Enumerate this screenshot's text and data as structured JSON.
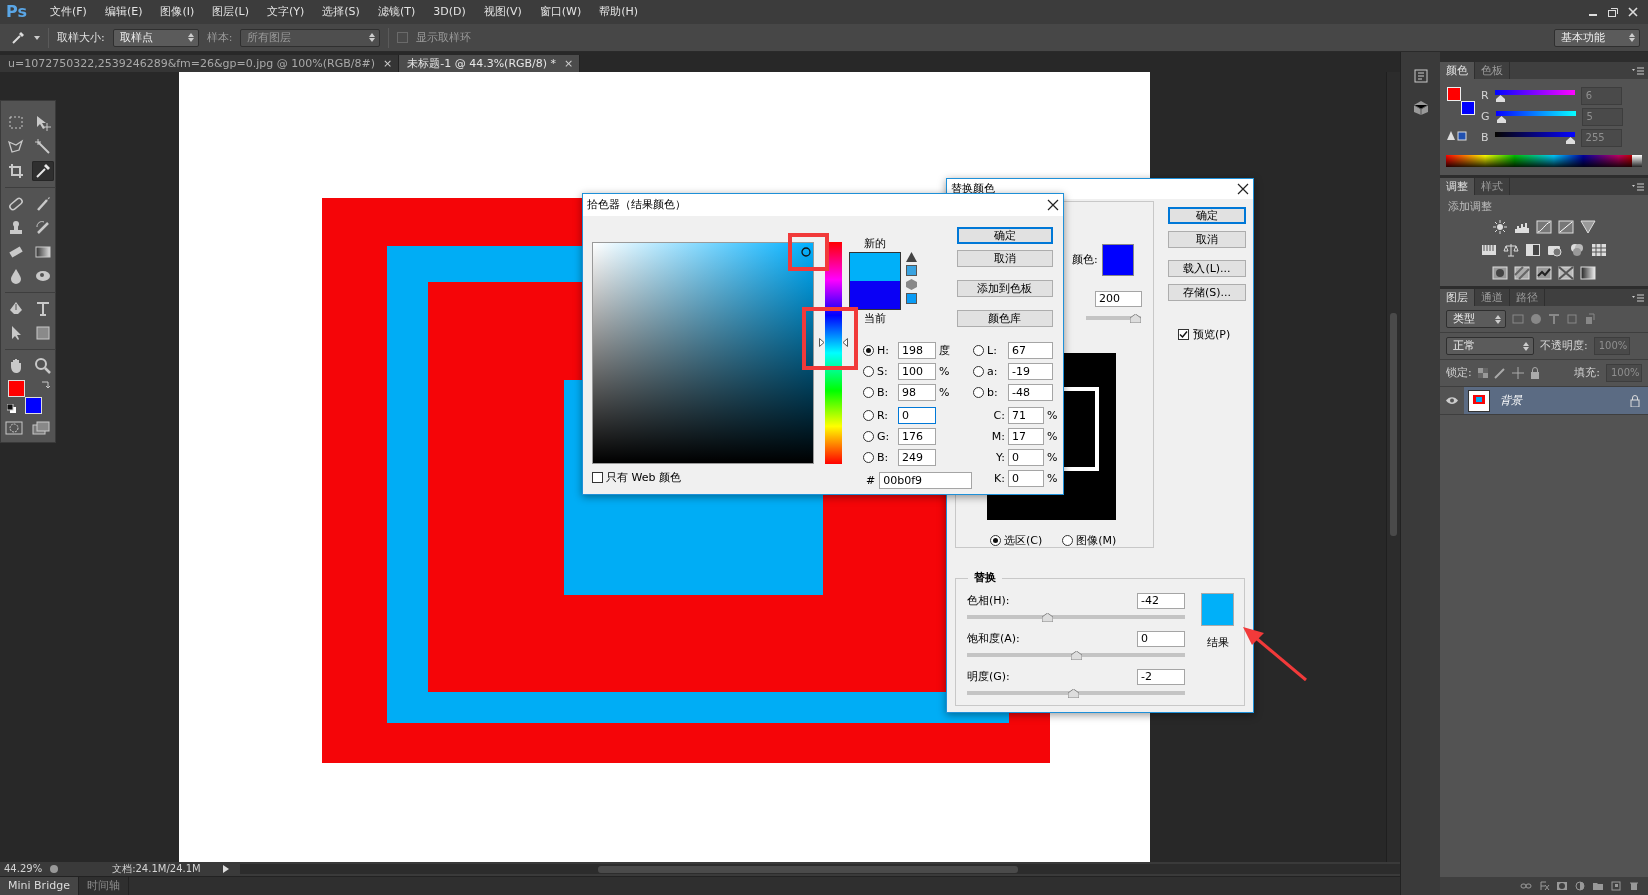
{
  "menu_bar": {
    "logo": "Ps",
    "items": [
      "文件(F)",
      "编辑(E)",
      "图像(I)",
      "图层(L)",
      "文字(Y)",
      "选择(S)",
      "滤镜(T)",
      "3D(D)",
      "视图(V)",
      "窗口(W)",
      "帮助(H)"
    ]
  },
  "options_bar": {
    "sample_size_label": "取样大小:",
    "sample_size": "取样点",
    "sample_label": "样本:",
    "sample": "所有图层",
    "show_ring": {
      "label": "显示取样环",
      "checked": false
    },
    "workspace": "基本功能"
  },
  "document_tabs": [
    {
      "label": "u=1072750322,2539246289&fm=26&gp=0.jpg @ 100%(RGB/8#)",
      "close": "×",
      "selected": false
    },
    {
      "label": "未标题-1 @ 44.3%(RGB/8) *",
      "close": "×",
      "selected": true
    }
  ],
  "tools": [
    {
      "kind": "marquee",
      "selected": false
    },
    {
      "kind": "move",
      "selected": false
    },
    {
      "kind": "lasso",
      "selected": false
    },
    {
      "kind": "wand",
      "selected": false
    },
    {
      "kind": "crop",
      "selected": false
    },
    {
      "kind": "eyedropper",
      "selected": true
    },
    {
      "kind": "healing",
      "selected": false
    },
    {
      "kind": "brush",
      "selected": false
    },
    {
      "kind": "stamp",
      "selected": false
    },
    {
      "kind": "history",
      "selected": false
    },
    {
      "kind": "eraser",
      "selected": false
    },
    {
      "kind": "gradient",
      "selected": false
    },
    {
      "kind": "blur",
      "selected": false
    },
    {
      "kind": "dodge",
      "selected": false
    },
    {
      "kind": "pen",
      "selected": false
    },
    {
      "kind": "type",
      "selected": false
    },
    {
      "kind": "path_select",
      "selected": false
    },
    {
      "kind": "shape",
      "selected": false
    },
    {
      "kind": "hand",
      "selected": false
    },
    {
      "kind": "zoom",
      "selected": false
    }
  ],
  "color_swatches": [
    {
      "kind": "foreground",
      "color": "#ff0000"
    },
    {
      "kind": "background",
      "color": "#0000ff"
    }
  ],
  "status_bar": {
    "zoom": "44.29%",
    "document": "文档:24.1M/24.1M"
  },
  "bottom_tabs": [
    {
      "label": "Mini Bridge",
      "selected": true
    },
    {
      "label": "时间轴",
      "selected": false
    }
  ],
  "color_panel": {
    "tabs": [
      {
        "label": "颜色",
        "selected": true
      },
      {
        "label": "色板",
        "selected": false
      }
    ],
    "swatches": [
      {
        "kind": "foreground",
        "color": "#ff0000"
      },
      {
        "kind": "background",
        "color": "#0000ff"
      }
    ],
    "channels": [
      {
        "label": "R",
        "value": "6",
        "level": 0.02
      },
      {
        "label": "G",
        "value": "5",
        "level": 0.02
      },
      {
        "label": "B",
        "value": "255",
        "level": 1
      }
    ]
  },
  "adjustments_panel": {
    "tabs": [
      {
        "label": "调整",
        "selected": true
      },
      {
        "label": "样式",
        "selected": false
      }
    ],
    "heading": "添加调整"
  },
  "layers_panel": {
    "tabs": [
      {
        "label": "图层",
        "selected": true
      },
      {
        "label": "通道",
        "selected": false
      },
      {
        "label": "路径",
        "selected": false
      }
    ],
    "filter": "类型",
    "blend_mode": "正常",
    "opacity_label": "不透明度:",
    "opacity": "100%",
    "lock_label": "锁定:",
    "fill_label": "填充:",
    "fill": "100%",
    "layers": [
      {
        "name": "背景",
        "visible": true,
        "locked": true,
        "selected": true
      }
    ]
  },
  "color_picker": {
    "title": "拾色器（结果颜色）",
    "swatches": [
      {
        "label": "新的",
        "color": "#00b0f9"
      },
      {
        "label": "当前",
        "color": "#0a00f5"
      }
    ],
    "hue_slider": {
      "level": 0.55
    },
    "buttons": [
      {
        "label": "确定",
        "default": true
      },
      {
        "label": "取消",
        "default": false
      },
      {
        "label": "添加到色板",
        "default": false
      },
      {
        "label": "颜色库",
        "default": false
      }
    ],
    "hsb": [
      {
        "label": "H:",
        "value": "198",
        "unit": "度",
        "selected": true
      },
      {
        "label": "S:",
        "value": "100",
        "unit": "%",
        "selected": false
      },
      {
        "label": "B:",
        "value": "98",
        "unit": "%",
        "selected": false
      }
    ],
    "rgb": [
      {
        "label": "R:",
        "value": "0",
        "selected": false
      },
      {
        "label": "G:",
        "value": "176",
        "selected": false
      },
      {
        "label": "B:",
        "value": "249",
        "selected": false
      }
    ],
    "lab": [
      {
        "label": "L:",
        "value": "67",
        "selected": false
      },
      {
        "label": "a:",
        "value": "-19",
        "selected": false
      },
      {
        "label": "b:",
        "value": "-48",
        "selected": false
      }
    ],
    "cmyk": [
      {
        "label": "C:",
        "value": "71",
        "unit": "%"
      },
      {
        "label": "M:",
        "value": "17",
        "unit": "%"
      },
      {
        "label": "Y:",
        "value": "0",
        "unit": "%"
      },
      {
        "label": "K:",
        "value": "0",
        "unit": "%"
      }
    ],
    "hex": {
      "label": "#",
      "value": "00b0f9"
    },
    "web_only": {
      "label": "只有 Web 颜色",
      "checked": false
    }
  },
  "replace_color": {
    "title": "替换颜色",
    "color_label": "颜色:",
    "color": "#0000ff",
    "fuzziness": {
      "value": "200",
      "level": 1
    },
    "view": [
      {
        "label": "选区(C)",
        "selected": true
      },
      {
        "label": "图像(M)",
        "selected": false
      }
    ],
    "buttons": [
      {
        "label": "确定",
        "default": true
      },
      {
        "label": "取消",
        "default": false
      },
      {
        "label": "载入(L)...",
        "default": false
      },
      {
        "label": "存储(S)...",
        "default": false
      }
    ],
    "preview": {
      "label": "预览(P)",
      "checked": true
    },
    "replace": {
      "legend": "替换",
      "sliders": [
        {
          "label": "色相(H):",
          "value": "-42",
          "level": 0.36
        },
        {
          "label": "饱和度(A):",
          "value": "0",
          "level": 0.5
        },
        {
          "label": "明度(G):",
          "value": "-2",
          "level": 0.49
        }
      ],
      "result": {
        "label": "结果",
        "color": "#00b0f9"
      }
    }
  }
}
